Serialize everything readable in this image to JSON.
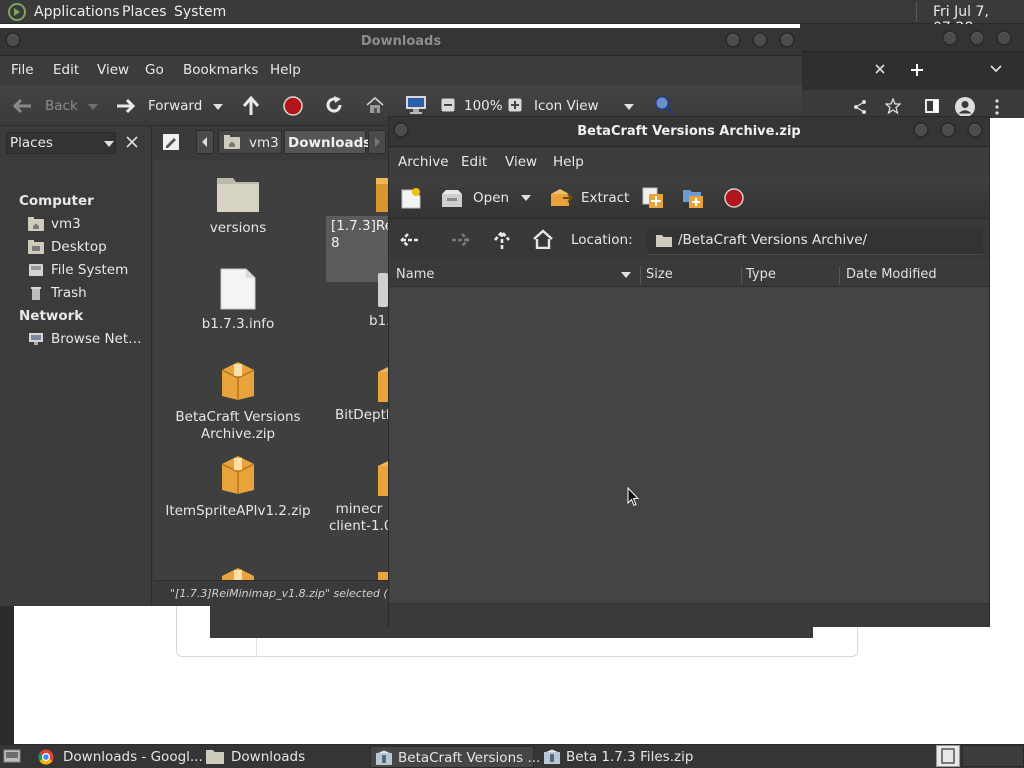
{
  "top_panel": {
    "applications": "Applications",
    "places": "Places",
    "system": "System",
    "clock": "Fri Jul  7, 07:28"
  },
  "caja": {
    "title": "Downloads",
    "menu": [
      "File",
      "Edit",
      "View",
      "Go",
      "Bookmarks",
      "Help"
    ],
    "toolbar": {
      "back": "Back",
      "forward": "Forward",
      "zoom": "100%",
      "view_mode": "Icon View"
    },
    "sidebar": {
      "selector": "Places",
      "computer_heading": "Computer",
      "computer_items": [
        "vm3",
        "Desktop",
        "File System",
        "Trash"
      ],
      "network_heading": "Network",
      "network_items": [
        "Browse Net…"
      ]
    },
    "pathbar": {
      "crumbs": [
        "vm3",
        "Downloads"
      ]
    },
    "files": [
      {
        "name": "versions",
        "icon": "folder-icon"
      },
      {
        "name": "[1.7.3]Rei\n8",
        "icon": "zip-icon"
      },
      {
        "name": "b1.7.3.info",
        "icon": "text-file-icon"
      },
      {
        "name": "b1.",
        "icon": "file-icon"
      },
      {
        "name": "BetaCraft Versions\nArchive.zip",
        "icon": "zip-icon"
      },
      {
        "name": "BitDepth",
        "icon": "zip-icon"
      },
      {
        "name": "ItemSpriteAPIv1.2.zip",
        "icon": "zip-icon"
      },
      {
        "name": "minecr\nclient-1.0.",
        "icon": "zip-icon"
      }
    ],
    "status": "\"[1.7.3]ReiMinimap_v1.8.zip\" selected (121.0"
  },
  "engrampa": {
    "title": "BetaCraft Versions Archive.zip",
    "menu": [
      "Archive",
      "Edit",
      "View",
      "Help"
    ],
    "toolbar": {
      "open": "Open",
      "extract": "Extract"
    },
    "location_label": "Location:",
    "location_value": "/BetaCraft Versions Archive/",
    "columns": [
      "Name",
      "Size",
      "Type",
      "Date Modified"
    ]
  },
  "taskbar": {
    "tasks": [
      "Downloads - Googl...",
      "Downloads",
      "BetaCraft Versions ...",
      "Beta 1.7.3 Files.zip"
    ]
  },
  "colors": {
    "panel_bg": "#3a3a3a",
    "window_bg": "#3c3c3c",
    "stop_red": "#b3161a",
    "folder_beige": "#d6d2c4",
    "zip_orange": "#e8a33c"
  }
}
